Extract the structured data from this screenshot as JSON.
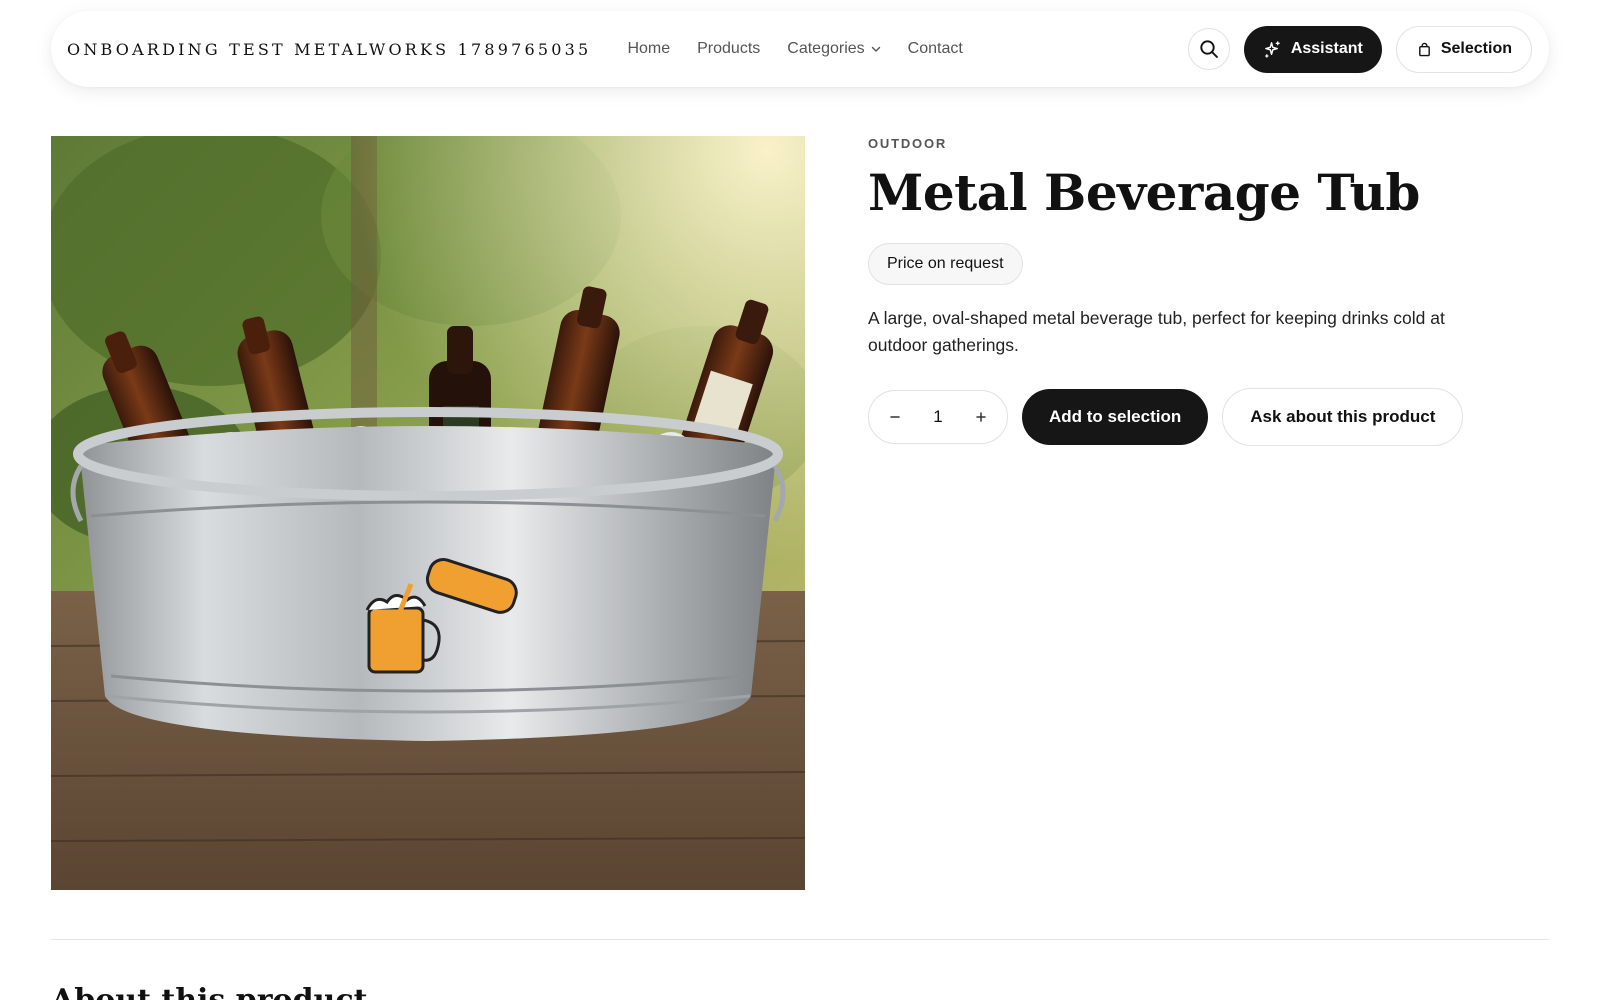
{
  "header": {
    "brand": "ONBOARDING TEST METALWORKS 1789765035",
    "nav": [
      {
        "label": "Home"
      },
      {
        "label": "Products"
      },
      {
        "label": "Categories",
        "has_dropdown": true
      },
      {
        "label": "Contact"
      }
    ],
    "search_icon": "search-icon",
    "assistant_label": "Assistant",
    "assistant_icon": "sparkles-icon",
    "selection_label": "Selection",
    "selection_icon": "shopping-bag-icon"
  },
  "product": {
    "category": "OUTDOOR",
    "title": "Metal Beverage Tub",
    "price_label": "Price on request",
    "description": "A large, oval-shaped metal beverage tub, perfect for keeping drinks cold at outdoor gatherings.",
    "quantity": "1",
    "add_label": "Add to selection",
    "ask_label": "Ask about this product"
  },
  "about": {
    "title": "About this product"
  },
  "colors": {
    "accent_dark": "#161616",
    "border": "#e2e2e2",
    "muted_text": "#555555"
  }
}
